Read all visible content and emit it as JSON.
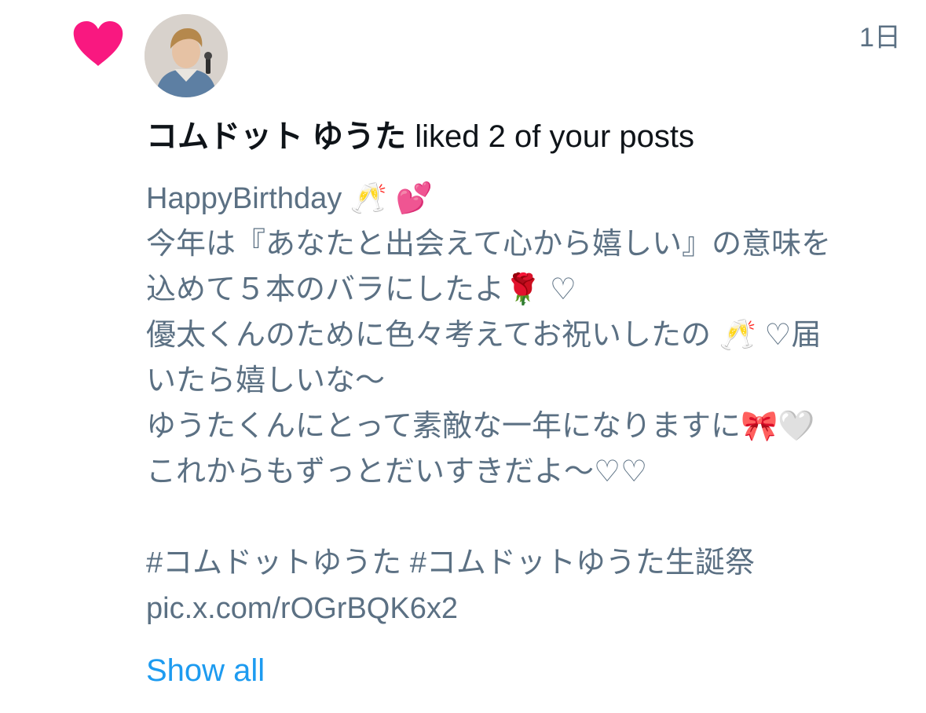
{
  "notification": {
    "timestamp": "1日",
    "user_name": "コムドット ゆうた",
    "action_text": " liked 2 of your posts",
    "post_lines": [
      "HappyBirthday 🥂 💕",
      "今年は『あなたと出会えて心から嬉しい』の意味を",
      "込めて５本のバラにしたよ🌹 ♡",
      "優太くんのために色々考えてお祝いしたの 🥂 ♡届",
      "いたら嬉しいな〜",
      "ゆうたくんにとって素敵な一年になりますに🎀🤍",
      "これからもずっとだいすきだよ〜♡♡",
      "",
      "#コムドットゆうた #コムドットゆうた生誕祭",
      "pic.x.com/rOGrBQK6x2"
    ],
    "show_all_label": "Show all",
    "icon": "heart-icon",
    "colors": {
      "heart": "#f91880",
      "name": "#0f1419",
      "body": "#5b7083",
      "link": "#1d9bf0"
    }
  }
}
